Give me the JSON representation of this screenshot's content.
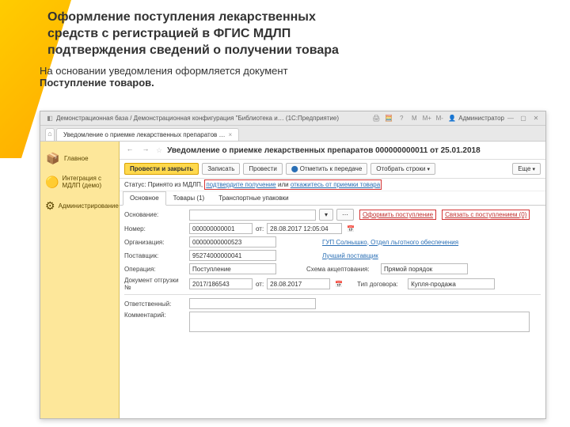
{
  "slide": {
    "title_l1": "Оформление поступления лекарственных",
    "title_l2": "средств с регистрацией в ФГИС МДЛП",
    "title_l3": "подтверждения сведений о получении товара",
    "sub1": "На основании уведомления оформляется документ",
    "sub2": "Поступление товаров."
  },
  "titlebar": {
    "text": "Демонстрационная база / Демонстрационная конфигурация \"Библиотека и… (1С:Предприятие)",
    "user": "Администратор"
  },
  "tabs": [
    {
      "label": "Уведомление о приемке лекарственных препаратов …"
    }
  ],
  "sidebar": {
    "items": [
      {
        "icon": "📦",
        "label": "Главное"
      },
      {
        "icon": "🟡",
        "label": "Интеграция с МДЛП (демо)"
      },
      {
        "icon": "⚙",
        "label": "Администрирование"
      }
    ]
  },
  "doc": {
    "star": "☆",
    "title": "Уведомление о приемке лекарственных препаратов 000000000011 от 25.01.2018"
  },
  "toolbar": {
    "post_close": "Провести и закрыть",
    "save": "Записать",
    "post": "Провести",
    "mark_transfer": "Отметить к передаче",
    "select_rows": "Отобрать строки",
    "more": "Еще"
  },
  "status": {
    "label": "Статус:",
    "value": "Принято из МДЛП,",
    "link1": "подтвердите получение",
    "or": "или",
    "link2": "откажитесь от приемки товара"
  },
  "subtabs": {
    "main": "Основное",
    "goods": "Товары (1)",
    "packs": "Транспортные упаковки"
  },
  "form": {
    "basis_lbl": "Основание:",
    "basis_link1": "Оформить поступление",
    "basis_link2": "Связать с поступлением (0)",
    "number_lbl": "Номер:",
    "number": "000000000001",
    "date_prefix": "от:",
    "date": "28.08.2017 12:05:04",
    "org_lbl": "Организация:",
    "org_code": "00000000000523",
    "org_link": "ГУП Солнышко, Отдел льготного обеспечения",
    "supplier_lbl": "Поставщик:",
    "supplier_code": "95274000000041",
    "supplier_link": "Лучший поставщик",
    "op_lbl": "Операция:",
    "op": "Поступление",
    "scheme_lbl": "Схема акцептования:",
    "scheme": "Прямой порядок",
    "ship_lbl": "Документ отгрузки №",
    "ship_no": "2017/186543",
    "ship_date": "28.08.2017",
    "deal_lbl": "Тип договора:",
    "deal": "Купля-продажа",
    "resp_lbl": "Ответственный:",
    "comment_lbl": "Комментарий:"
  }
}
